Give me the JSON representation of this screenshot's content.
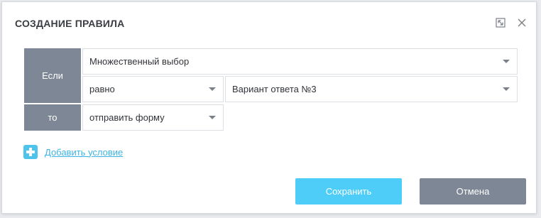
{
  "dialog": {
    "title": "СОЗДАНИЕ ПРАВИЛА"
  },
  "rule": {
    "if_label": "Если",
    "then_label": "то",
    "question_select": {
      "value": "Множественный выбор"
    },
    "operator_select": {
      "value": "равно"
    },
    "answer_select": {
      "value": "Вариант ответа №3"
    },
    "action_select": {
      "value": "отправить форму"
    }
  },
  "add_condition": {
    "label": "Добавить условие"
  },
  "buttons": {
    "save": "Сохранить",
    "cancel": "Отмена"
  },
  "colors": {
    "label_bg": "#7e8795",
    "accent": "#4ecdf9",
    "link": "#3fb3e5"
  },
  "icons": {
    "expand": "expand-icon",
    "close": "close-icon",
    "add": "plus-icon",
    "dropdown": "caret-down-icon"
  }
}
